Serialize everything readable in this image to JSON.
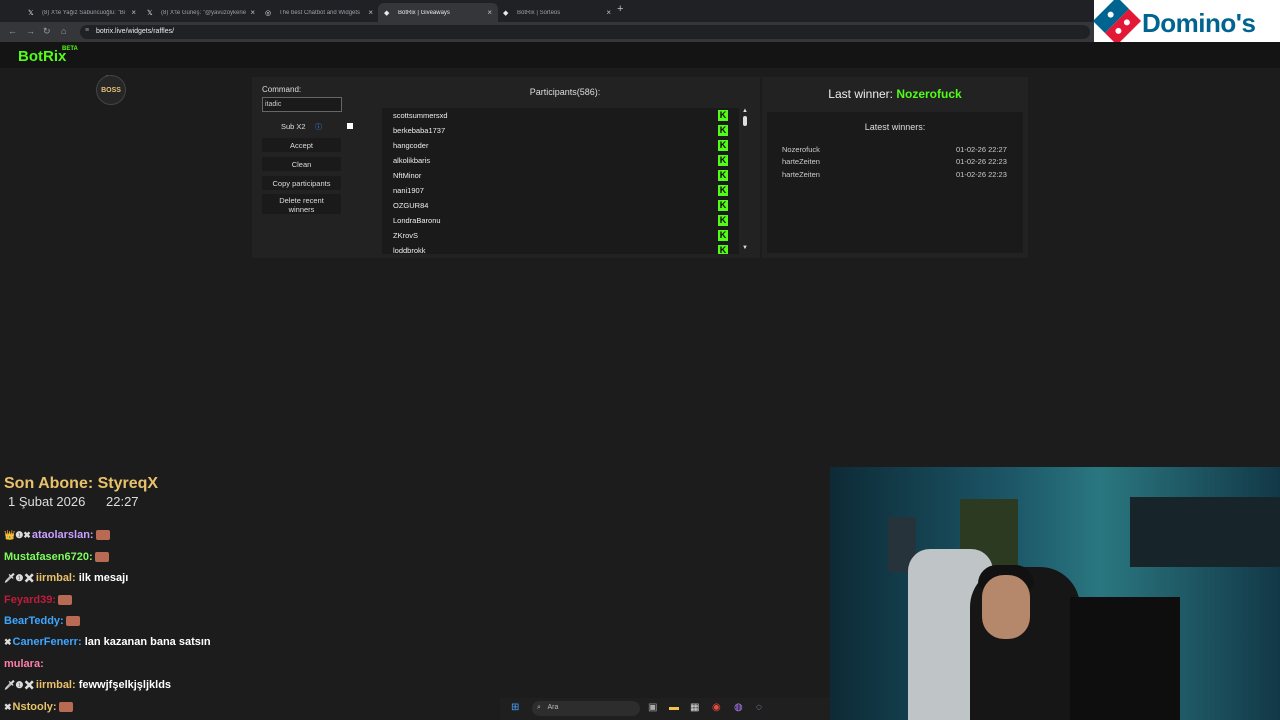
{
  "browser": {
    "tabs": [
      {
        "icon": "𝕏",
        "title": "(8) X'te Yağız Sabuncuoğlu: \"Bi",
        "active": false
      },
      {
        "icon": "𝕏",
        "title": "(8) X'te Güneş: \"@yavuzoykene",
        "active": false
      },
      {
        "icon": "◎",
        "title": "The best Chatbot and Widgets",
        "active": false
      },
      {
        "icon": "◆",
        "title": "BotRix | Giveaways",
        "active": true
      },
      {
        "icon": "◆",
        "title": "BotRix | Sorteos",
        "active": false
      }
    ],
    "new_tab": "+",
    "close": "×",
    "url": "botrix.live/widgets/raffles/"
  },
  "ad": {
    "brand": "Domino's"
  },
  "botrix": {
    "logo": "BotRix",
    "beta": "BETA",
    "badge": "BOSS"
  },
  "raffle": {
    "command_label": "Command:",
    "command_value": "itadic",
    "sub_x2": "Sub X2",
    "buttons": [
      "Accept",
      "Clean",
      "Copy participants",
      "Delete recent winners"
    ],
    "participants_title": "Participants(586):",
    "participants": [
      "scottsummersxd",
      "berkebaba1737",
      "hangcoder",
      "alkolikbaris",
      "NftMinor",
      "nani1907",
      "OZGUR84",
      "LondraBaronu",
      "ZKrovS",
      "loddbrokk"
    ],
    "last_winner_label": "Last winner:",
    "last_winner": "Nozerofuck",
    "latest_winners_title": "Latest winners:",
    "latest_winners": [
      {
        "name": "Nozerofuck",
        "date": "01-02-26 22:27"
      },
      {
        "name": "harteZeiten",
        "date": "01-02-26 22:23"
      },
      {
        "name": "harteZeiten",
        "date": "01-02-26 22:23"
      }
    ]
  },
  "stream": {
    "last_sub": "Son Abone: StyreqX",
    "date": "1 Şubat 2026",
    "time": "22:27",
    "chat": [
      {
        "badges": "👑❶✖",
        "user": "ataolarslan:",
        "color": "#c9a0ff",
        "msg": ""
      },
      {
        "badges": "",
        "user": "Mustafasen6720:",
        "color": "#7cfc5a",
        "msg": ""
      },
      {
        "badges": "🗡❶✖",
        "user": "iirmbal:",
        "color": "#e8c26a",
        "msg": "ilk mesajı"
      },
      {
        "badges": "",
        "user": "Feyard39:",
        "color": "#c01c3a",
        "msg": ""
      },
      {
        "badges": "",
        "user": "BearTeddy:",
        "color": "#3ea6ff",
        "msg": ""
      },
      {
        "badges": "✖",
        "user": "CanerFenerr:",
        "color": "#3ea6ff",
        "msg": "lan kazanan bana satsın"
      },
      {
        "badges": "",
        "user": "mulara:",
        "color": "#ff7fa8",
        "msg": ""
      },
      {
        "badges": "🗡❶✖",
        "user": "iirmbal:",
        "color": "#e8c26a",
        "msg": "fewwjfşelkjşljklds"
      },
      {
        "badges": "✖",
        "user": "Nstooly:",
        "color": "#e8c26a",
        "msg": ""
      }
    ]
  },
  "taskbar": {
    "search_placeholder": "Ara"
  }
}
